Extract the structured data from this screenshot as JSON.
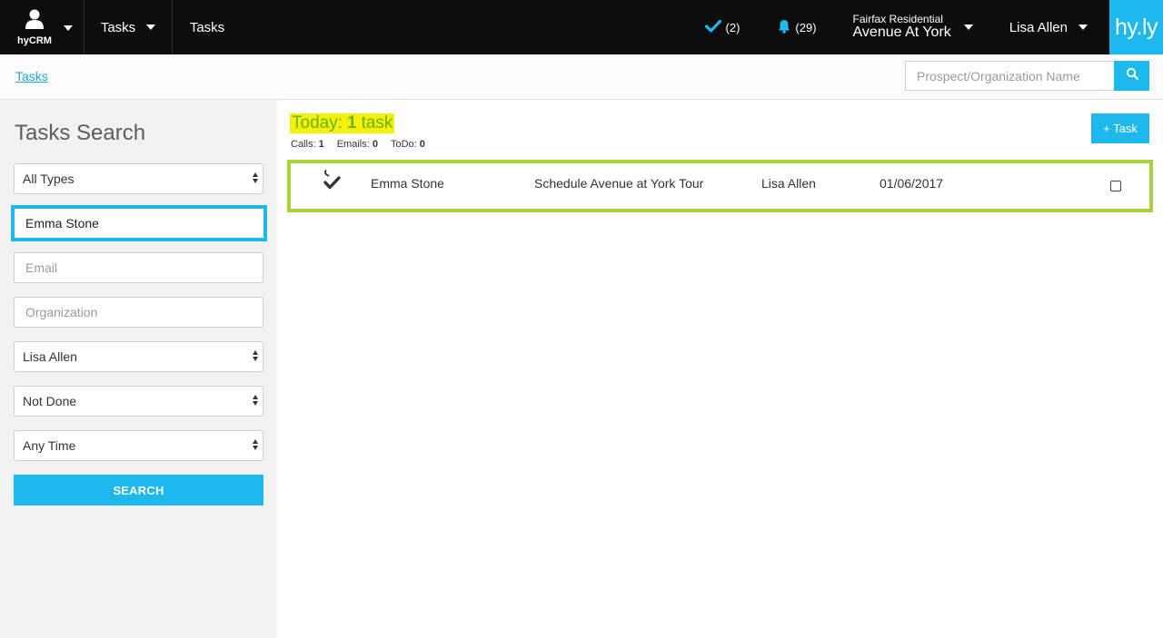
{
  "topbar": {
    "brand_label": "hyCRM",
    "nav_dropdown_label": "Tasks",
    "nav_link_label": "Tasks",
    "tasks_count": "(2)",
    "alerts_count": "(29)",
    "property_org": "Fairfax Residential",
    "property_name": "Avenue At York",
    "user_name": "Lisa Allen",
    "logo_text": "hy.ly"
  },
  "subbar": {
    "breadcrumb": "Tasks",
    "search_placeholder": "Prospect/Organization Name"
  },
  "sidebar": {
    "title": "Tasks Search",
    "type_select": "All Types",
    "name_input": "Emma Stone",
    "email_placeholder": "Email",
    "organization_placeholder": "Organization",
    "assignee_select": "Lisa Allen",
    "status_select": "Not Done",
    "time_select": "Any Time",
    "search_button": "SEARCH"
  },
  "main": {
    "today_prefix": "Today:",
    "today_count": "1",
    "today_suffix": "task",
    "stats": {
      "calls_label": "Calls:",
      "calls_count": "1",
      "emails_label": "Emails:",
      "emails_count": "0",
      "todo_label": "ToDo:",
      "todo_count": "0"
    },
    "add_task_label": "+ Task",
    "tasks": [
      {
        "contact": "Emma Stone",
        "title": "Schedule Avenue at York Tour",
        "assignee": "Lisa Allen",
        "date": "01/06/2017",
        "icon": "phone-check-icon"
      }
    ]
  },
  "colors": {
    "accent": "#1db8ec",
    "topbar": "#0d0d0d",
    "highlight": "#f4f00a",
    "today_text": "#6ab31b",
    "row_border": "#a9d13c"
  }
}
